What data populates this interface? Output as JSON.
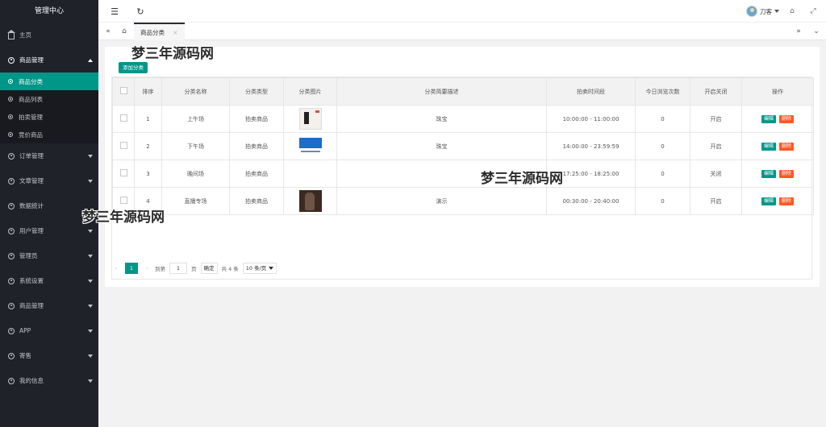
{
  "app": {
    "title": "管理中心"
  },
  "sidebar": {
    "home": "主页",
    "product_mgmt": "商品管理",
    "sub_items": [
      "商品分类",
      "商品列表",
      "拍卖管理",
      "竞价商品"
    ],
    "items": [
      "订单管理",
      "文章管理",
      "数据统计",
      "用户管理",
      "管理员",
      "系统设置",
      "商品管理",
      "APP",
      "寄售",
      "我的信息"
    ]
  },
  "header": {
    "user_name": "刀客"
  },
  "tabs": {
    "active": "商品分类",
    "close": "×"
  },
  "toolbar": {
    "add_label": "添加分类"
  },
  "table": {
    "headers": [
      "排序",
      "分类名称",
      "分类类型",
      "分类图片",
      "分类简要描述",
      "拍卖时间段",
      "今日浏览次数",
      "开启关闭",
      "操作"
    ],
    "edit_label": "编辑",
    "delete_label": "删除",
    "rows": [
      {
        "sort": "1",
        "name": "上午场",
        "type": "拍卖商品",
        "desc": "珠宝",
        "time": "10:00:00  -  11:00:00",
        "views": "0",
        "status": "开启"
      },
      {
        "sort": "2",
        "name": "下午场",
        "type": "拍卖商品",
        "desc": "珠宝",
        "time": "14:00:00  -  23:59:59",
        "views": "0",
        "status": "开启"
      },
      {
        "sort": "3",
        "name": "晚间场",
        "type": "拍卖商品",
        "desc": "",
        "time": "17:25:00  -  18:25:00",
        "views": "0",
        "status": "关闭"
      },
      {
        "sort": "4",
        "name": "直播专场",
        "type": "拍卖商品",
        "desc": "演示",
        "time": "00:30:00  -  20:40:00",
        "views": "0",
        "status": "开启"
      }
    ]
  },
  "pager": {
    "current": "1",
    "goto_label": "到第",
    "page_input": "1",
    "page_unit": "页",
    "confirm": "确定",
    "total": "共 4 条",
    "per_page": "10 条/页"
  },
  "watermark": "梦三年源码网"
}
